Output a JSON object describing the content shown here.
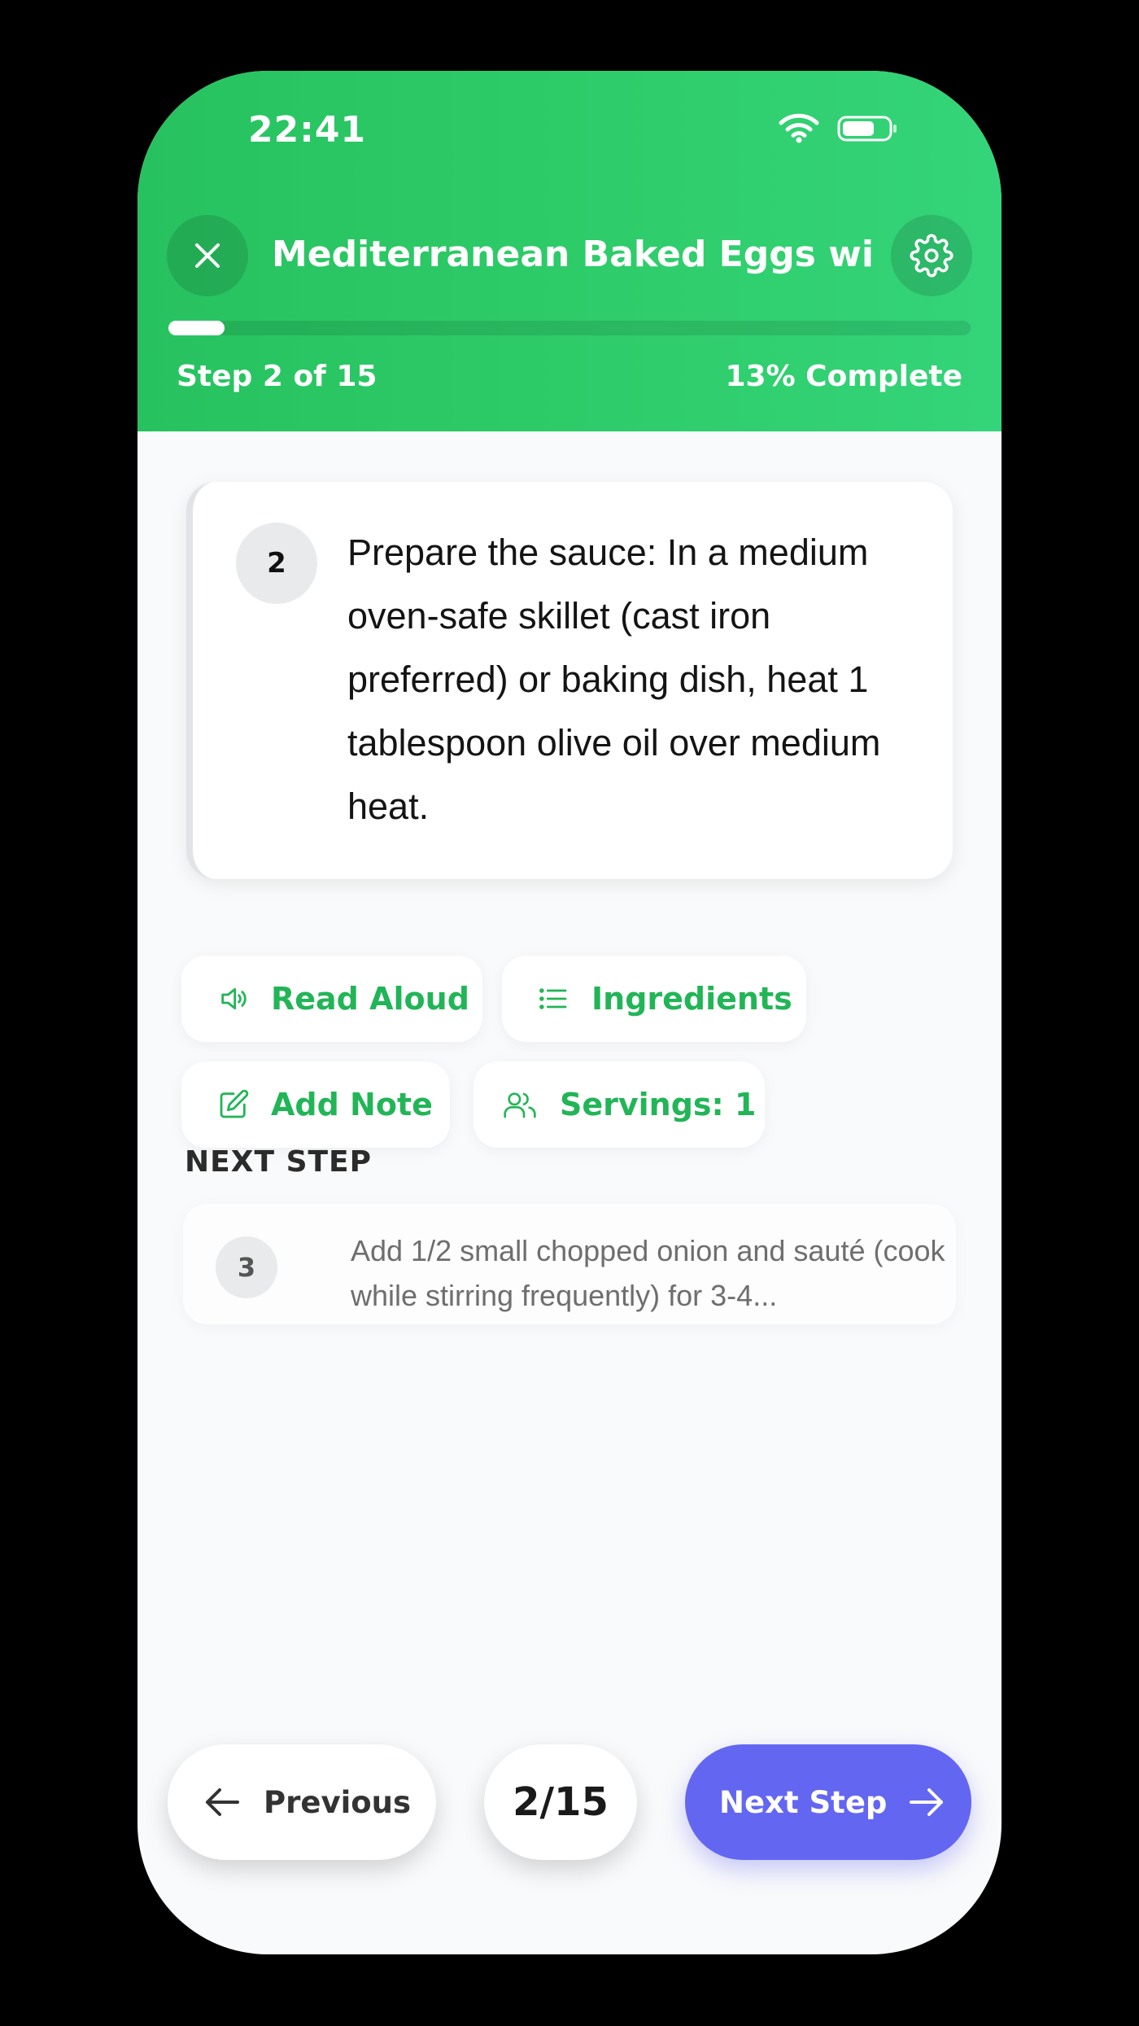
{
  "status_bar": {
    "time": "22:41"
  },
  "header": {
    "title": "Mediterranean Baked Eggs wit...",
    "step_label": "Step 2 of 15",
    "complete_label": "13% Complete",
    "progress_fraction": 0.07
  },
  "current_step": {
    "number": "2",
    "text": "Prepare the sauce: In a medium oven-safe skillet (cast iron preferred) or baking dish, heat 1 tablespoon olive oil over medium heat."
  },
  "actions": {
    "read_aloud": "Read Aloud",
    "ingredients": "Ingredients",
    "add_note": "Add Note",
    "servings": "Servings: 1"
  },
  "next_step": {
    "heading": "NEXT STEP",
    "number": "3",
    "text": "Add 1/2 small chopped onion and sauté (cook while stirring frequently) for 3-4..."
  },
  "nav": {
    "previous": "Previous",
    "page": "2/15",
    "next": "Next Step"
  },
  "colors": {
    "header_green": "#2fcd6b",
    "accent_green": "#22b557",
    "next_button": "#6366f1"
  },
  "icons": {
    "close": "close-icon",
    "settings": "gear-icon",
    "read_aloud": "speaker-icon",
    "ingredients": "list-icon",
    "add_note": "edit-note-icon",
    "servings": "users-icon",
    "previous": "arrow-left-icon",
    "next": "arrow-right-icon"
  }
}
